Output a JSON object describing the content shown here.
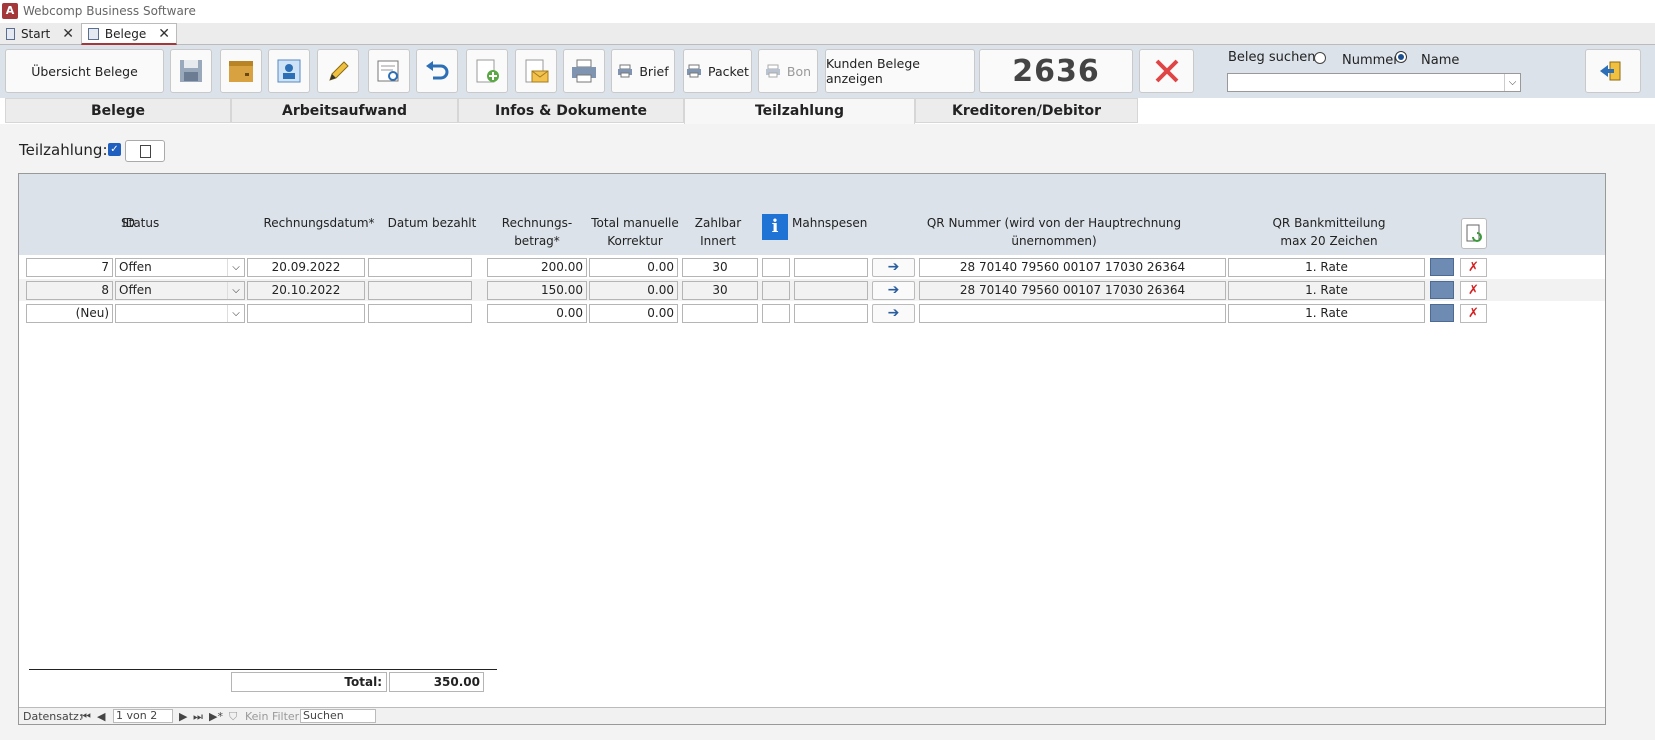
{
  "app": {
    "title": "Webcomp Business Software",
    "logo_letter": "A"
  },
  "doc_tabs": [
    {
      "label": "Start"
    },
    {
      "label": "Belege"
    }
  ],
  "toolbar": {
    "overview_label": "Übersicht Belege",
    "brief_label": "Brief",
    "packet_label": "Packet",
    "bon_label": "Bon",
    "kunden_label": "Kunden Belege anzeigen",
    "beleg_number": "2636",
    "search_label": "Beleg suchen:",
    "radio_nummer": "Nummer",
    "radio_name": "Name",
    "search_value": ""
  },
  "form_tabs": [
    {
      "label": "Belege"
    },
    {
      "label": "Arbeitsaufwand"
    },
    {
      "label": "Infos & Dokumente"
    },
    {
      "label": "Teilzahlung"
    },
    {
      "label": "Kreditoren/Debitor"
    }
  ],
  "teilzahlung": {
    "label": "Teilzahlung:",
    "checked": true
  },
  "columns": {
    "id": "ID",
    "status": "Status",
    "rechnungsdatum": "Rechnungsdatum*",
    "datum_bezahlt": "Datum bezahlt",
    "betrag_1": "Rechnungs-",
    "betrag_2": "betrag*",
    "korrektur_1": "Total manuelle",
    "korrektur_2": "Korrektur",
    "zahlbar_1": "Zahlbar",
    "zahlbar_2": "Innert",
    "info": "i",
    "mahnspesen": "Mahnspesen",
    "qr_1": "QR Nummer (wird von der Hauptrechnung",
    "qr_2": "ünernommen)",
    "bank_1": "QR Bankmitteilung",
    "bank_2": "max 20 Zeichen"
  },
  "rows": [
    {
      "id": "7",
      "status": "Offen",
      "rechnungsdatum": "20.09.2022",
      "datum_bezahlt": "",
      "betrag": "200.00",
      "korrektur": "0.00",
      "zahlbar": "30",
      "info": "",
      "mahnspesen": "",
      "arrow": "➔",
      "qr": "28 70140 79560 00107 17030 26364",
      "bank": "1. Rate"
    },
    {
      "id": "8",
      "status": "Offen",
      "rechnungsdatum": "20.10.2022",
      "datum_bezahlt": "",
      "betrag": "150.00",
      "korrektur": "0.00",
      "zahlbar": "30",
      "info": "",
      "mahnspesen": "",
      "arrow": "➔",
      "qr": "28 70140 79560 00107 17030 26364",
      "bank": "1. Rate"
    },
    {
      "id": "(Neu)",
      "status": "",
      "rechnungsdatum": "",
      "datum_bezahlt": "",
      "betrag": "0.00",
      "korrektur": "0.00",
      "zahlbar": "",
      "info": "",
      "mahnspesen": "",
      "arrow": "➔",
      "qr": "",
      "bank": "1. Rate"
    }
  ],
  "totals": {
    "label": "Total:",
    "value": "350.00"
  },
  "navbar": {
    "label": "Datensatz:",
    "first": "⏮",
    "prev": "◀",
    "position": "1 von 2",
    "next": "▶",
    "last": "⏭",
    "new": "▶*",
    "filter": "Kein Filter",
    "search": "Suchen"
  },
  "colors": {
    "accent": "#a4373a",
    "header_bg": "#dbe2ea",
    "info_blue": "#1e73d4",
    "delete_red": "#d42020"
  }
}
